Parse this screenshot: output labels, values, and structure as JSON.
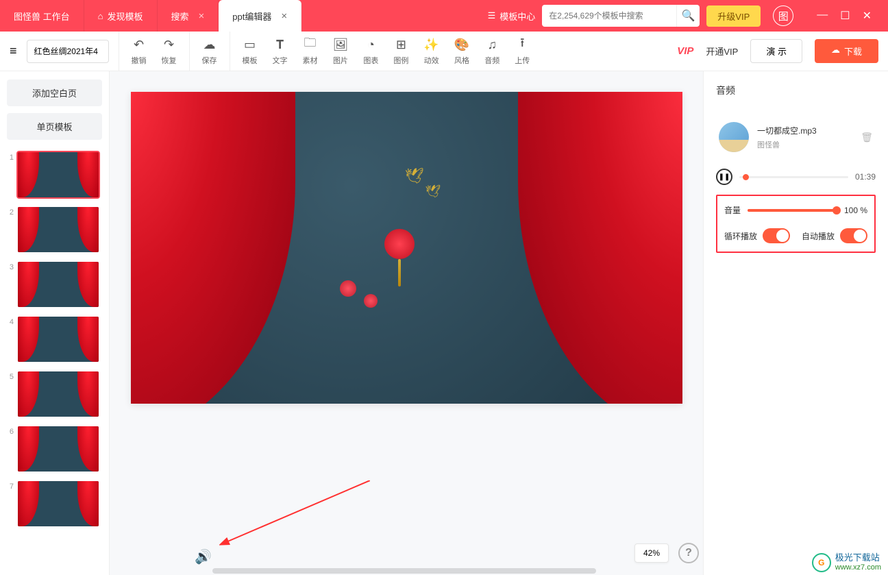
{
  "titlebar": {
    "tabs": [
      {
        "label": "图怪兽  工作台"
      },
      {
        "label": "发现模板",
        "has_home": true
      },
      {
        "label": "搜索",
        "closable": true
      },
      {
        "label": "ppt编辑器",
        "closable": true,
        "active": true
      }
    ],
    "template_center": "模板中心",
    "search_placeholder": "在2,254,629个模板中搜索",
    "upgrade_vip": "升级VIP",
    "picture_icon_label": "图"
  },
  "toolbar": {
    "doc_name": "红色丝绸2021年4",
    "undo": "撤销",
    "redo": "恢复",
    "save": "保存",
    "items": [
      "模板",
      "文字",
      "素材",
      "图片",
      "图表",
      "图例",
      "动效",
      "风格",
      "音频",
      "上传"
    ],
    "vip_badge": "VIP",
    "open_vip": "开通VIP",
    "preview": "演 示",
    "download": "下载"
  },
  "left": {
    "add_blank": "添加空白页",
    "single_template": "单页模板",
    "thumb_count": 7,
    "active_thumb": 1
  },
  "canvas": {
    "zoom": "42%"
  },
  "audio_panel": {
    "title": "音频",
    "file_name": "一切都成空.mp3",
    "file_source": "图怪兽",
    "time": "01:39",
    "volume_label": "音量",
    "volume_value": "100 %",
    "loop_label": "循环播放",
    "autoplay_label": "自动播放"
  },
  "watermark": {
    "main": "极光下载站",
    "sub": "www.xz7.com"
  }
}
